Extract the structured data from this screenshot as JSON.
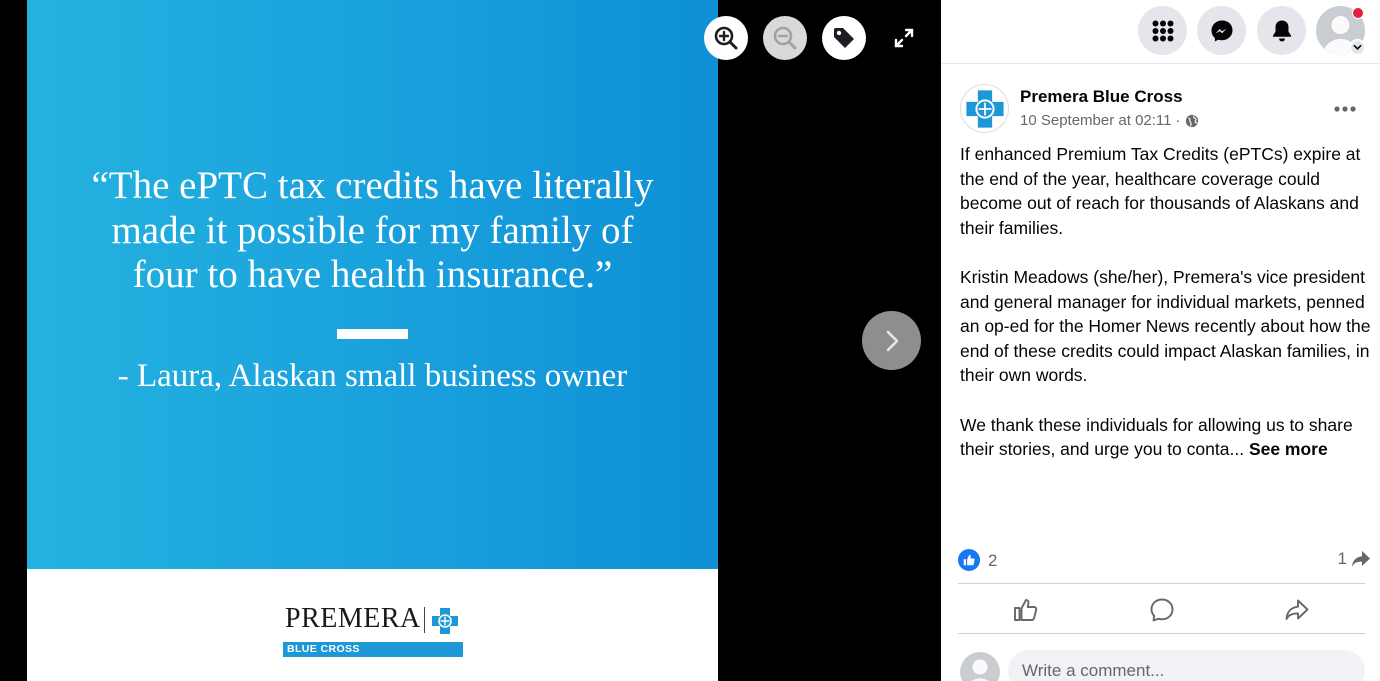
{
  "slide": {
    "quote_lines": [
      "“The ePTC tax credits have literally",
      "made it possible for my family of",
      "four to have health insurance.”"
    ],
    "attribution": "- Laura, Alaskan small business owner",
    "brand_name": "PREMERA",
    "brand_sub": "BLUE CROSS"
  },
  "viewer_controls": {
    "zoom_in": "zoom-in-icon",
    "zoom_out": "zoom-out-icon",
    "tag": "tag-icon",
    "expand": "expand-icon",
    "next": "chevron-right-icon"
  },
  "topbar": {
    "icons": [
      "menu-grid-icon",
      "messenger-icon",
      "bell-icon",
      "profile-avatar"
    ]
  },
  "post": {
    "page_name": "Premera Blue Cross",
    "timestamp": "10 September at 02:11",
    "separator": "·",
    "audience_icon": "globe-icon",
    "paragraphs": [
      "If enhanced Premium Tax Credits (ePTCs) expire at the end of the year, healthcare coverage could become out of reach for thousands of Alaskans and their families.",
      "Kristin Meadows (she/her), Premera's vice president and general manager for individual markets, penned an op-ed for the Homer News recently about how the end of these credits could impact Alaskan families, in their own words."
    ],
    "truncated_paragraph": "We thank these individuals for allowing us to share their stories, and urge you to conta...",
    "see_more": "See more",
    "like_count": "2",
    "share_count": "1"
  },
  "comment": {
    "placeholder": "Write a comment..."
  },
  "colors": {
    "slide_blue": "#1aa2dd",
    "facebook_blue": "#1877f2",
    "notification_red": "#e41e3f"
  }
}
